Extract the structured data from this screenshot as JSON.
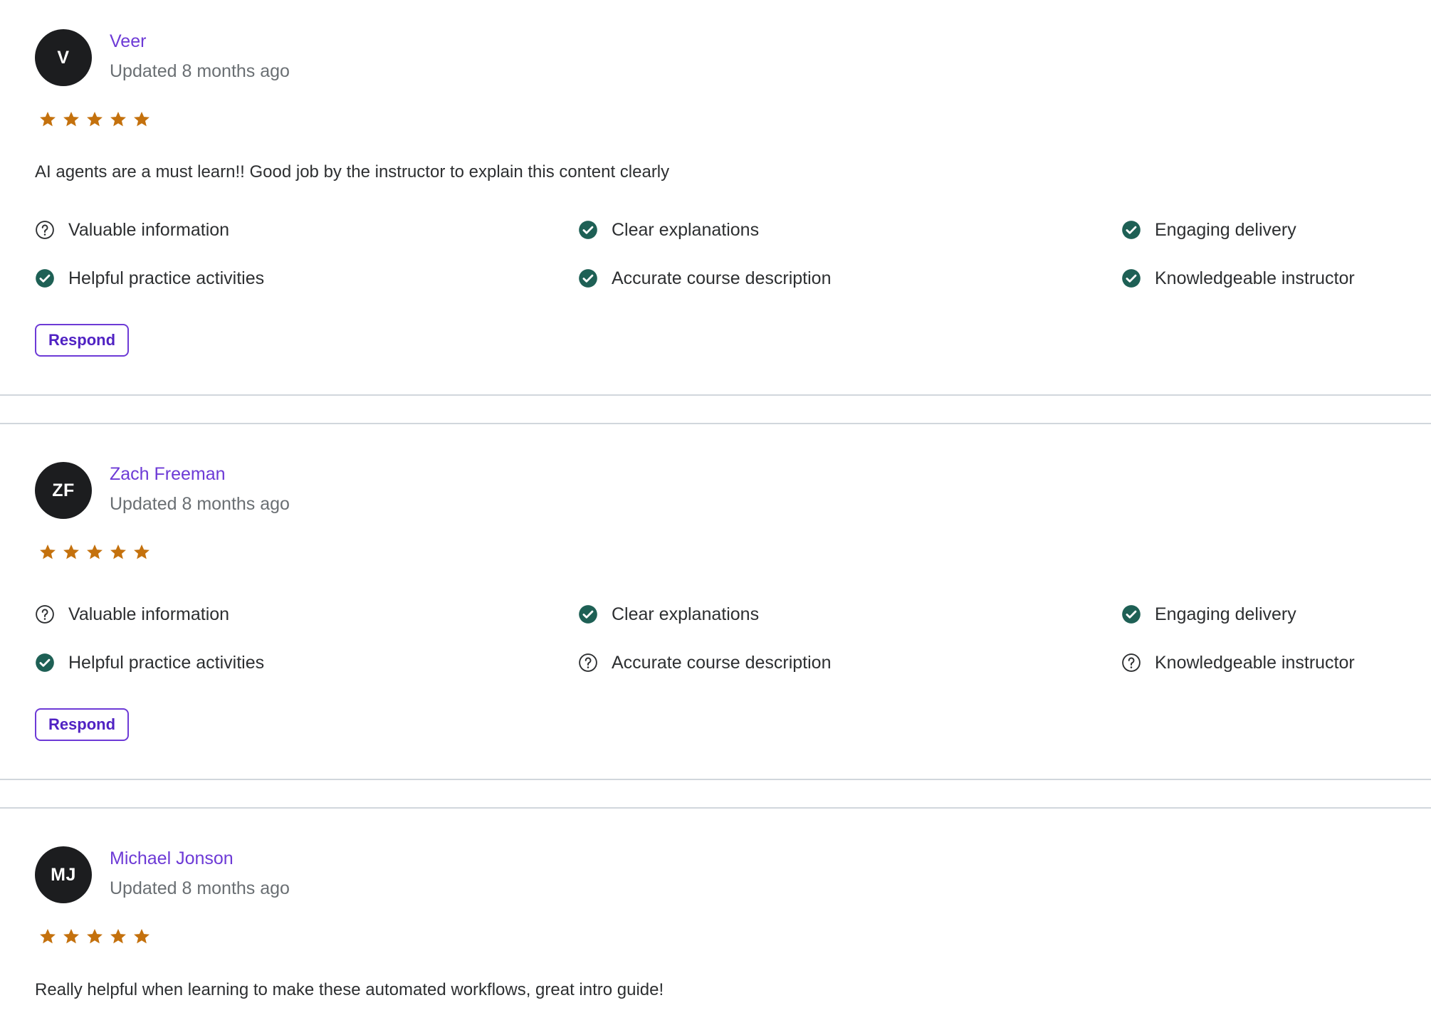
{
  "colors": {
    "accent": "#6d3ad6",
    "star": "#c4710d",
    "check": "#1e6055",
    "avatar_bg": "#1c1d1f",
    "divider": "#d1d7dc"
  },
  "rating_icon": "star-icon",
  "reviews": [
    {
      "initials": "V",
      "name": "Veer",
      "updated": "Updated 8 months ago",
      "rating": 5,
      "comment": "AI agents are a must learn!! Good job by the instructor to explain this content clearly",
      "feedback": [
        {
          "label": "Valuable information",
          "icon": "question-circle-icon"
        },
        {
          "label": "Clear explanations",
          "icon": "check-circle-icon"
        },
        {
          "label": "Engaging delivery",
          "icon": "check-circle-icon"
        },
        {
          "label": "Helpful practice activities",
          "icon": "check-circle-icon"
        },
        {
          "label": "Accurate course description",
          "icon": "check-circle-icon"
        },
        {
          "label": "Knowledgeable instructor",
          "icon": "check-circle-icon"
        }
      ],
      "respond_label": "Respond"
    },
    {
      "initials": "ZF",
      "name": "Zach Freeman",
      "updated": "Updated 8 months ago",
      "rating": 5,
      "comment": "",
      "feedback": [
        {
          "label": "Valuable information",
          "icon": "question-circle-icon"
        },
        {
          "label": "Clear explanations",
          "icon": "check-circle-icon"
        },
        {
          "label": "Engaging delivery",
          "icon": "check-circle-icon"
        },
        {
          "label": "Helpful practice activities",
          "icon": "check-circle-icon"
        },
        {
          "label": "Accurate course description",
          "icon": "question-circle-icon"
        },
        {
          "label": "Knowledgeable instructor",
          "icon": "question-circle-icon"
        }
      ],
      "respond_label": "Respond"
    },
    {
      "initials": "MJ",
      "name": "Michael Jonson",
      "updated": "Updated 8 months ago",
      "rating": 5,
      "comment": "Really helpful when learning to make these automated workflows, great intro guide!"
    }
  ]
}
